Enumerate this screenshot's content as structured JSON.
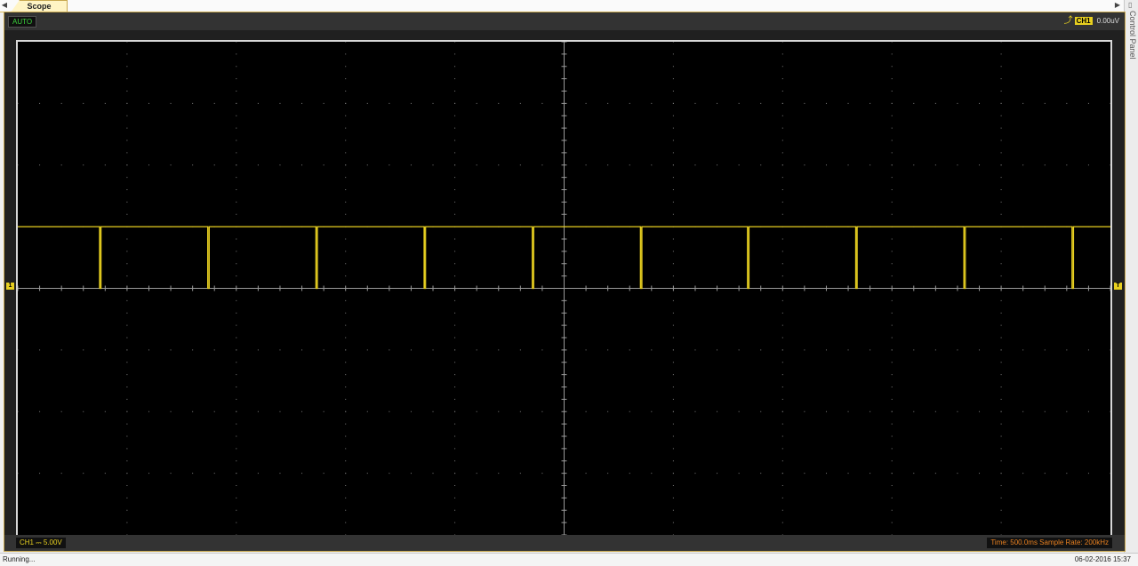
{
  "tabs": {
    "active": "Scope"
  },
  "control_panel": {
    "label": "Control Panel"
  },
  "scope": {
    "mode": "AUTO",
    "trigger": {
      "channel": "CH1",
      "level": "0.00uV"
    },
    "channel_readout": "CH1 ⎓  5.00V",
    "time_readout": "Time: 500.0ms    Sample Rate: 200kHz",
    "channel_marker": "1",
    "trigger_marker": "T",
    "trace_color": "#e8d020"
  },
  "status": {
    "left": "Running...",
    "right": "06-02-2016 15:37"
  },
  "chart_data": {
    "type": "line",
    "title": "",
    "xlabel": "",
    "ylabel": "",
    "grid": true,
    "divisions": {
      "x": 10,
      "y": 8
    },
    "baseline_div": 0,
    "high_level_div": 1,
    "pulses_div": [
      0.75,
      1.74,
      2.73,
      3.72,
      4.71,
      5.7,
      6.68,
      7.67,
      8.66,
      9.65
    ]
  }
}
